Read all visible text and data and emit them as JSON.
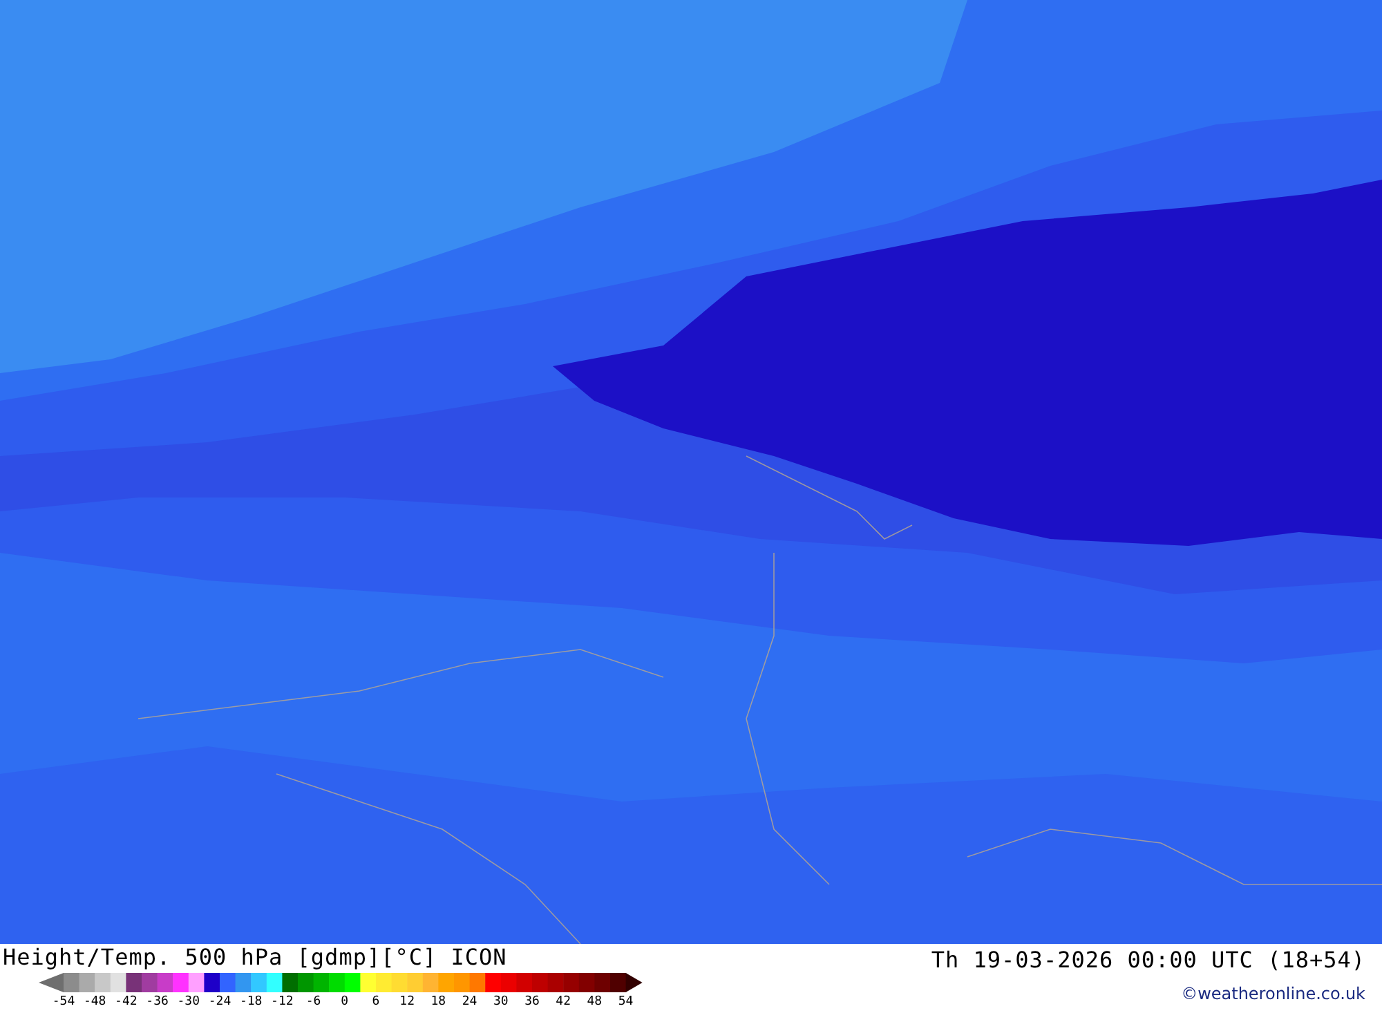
{
  "map": {
    "title": "Height/Temp. 500 hPa [gdmp][°C] ICON",
    "valid_time": "Th 19-03-2026 00:00 UTC (18+54)",
    "credit": "©weatheronline.co.uk"
  },
  "legend": {
    "swatches": [
      {
        "color": "#8c8c8c"
      },
      {
        "color": "#aaaaaa"
      },
      {
        "color": "#c8c8c8"
      },
      {
        "color": "#e1e1e1"
      },
      {
        "color": "#783278"
      },
      {
        "color": "#a03ca0"
      },
      {
        "color": "#c83cc8"
      },
      {
        "color": "#ff32ff"
      },
      {
        "color": "#ffa0ff"
      },
      {
        "color": "#1e00c8"
      },
      {
        "color": "#3264ff"
      },
      {
        "color": "#3296f0"
      },
      {
        "color": "#32c8ff"
      },
      {
        "color": "#32ffff"
      },
      {
        "color": "#006e00"
      },
      {
        "color": "#009600"
      },
      {
        "color": "#00b400"
      },
      {
        "color": "#00dc00"
      },
      {
        "color": "#00ff00"
      },
      {
        "color": "#ffff32"
      },
      {
        "color": "#ffeb32"
      },
      {
        "color": "#ffdc32"
      },
      {
        "color": "#ffcd32"
      },
      {
        "color": "#ffb432"
      },
      {
        "color": "#ffa500"
      },
      {
        "color": "#ff9600"
      },
      {
        "color": "#ff7800"
      },
      {
        "color": "#ff0000"
      },
      {
        "color": "#eb0000"
      },
      {
        "color": "#d20000"
      },
      {
        "color": "#be0000"
      },
      {
        "color": "#aa0000"
      },
      {
        "color": "#960000"
      },
      {
        "color": "#820000"
      },
      {
        "color": "#6e0000"
      },
      {
        "color": "#500000"
      }
    ],
    "ticks": [
      "-54",
      "-48",
      "-42",
      "-36",
      "-30",
      "-24",
      "-18",
      "-12",
      "-6",
      "0",
      "6",
      "12",
      "18",
      "24",
      "30",
      "36",
      "42",
      "48",
      "54"
    ]
  }
}
